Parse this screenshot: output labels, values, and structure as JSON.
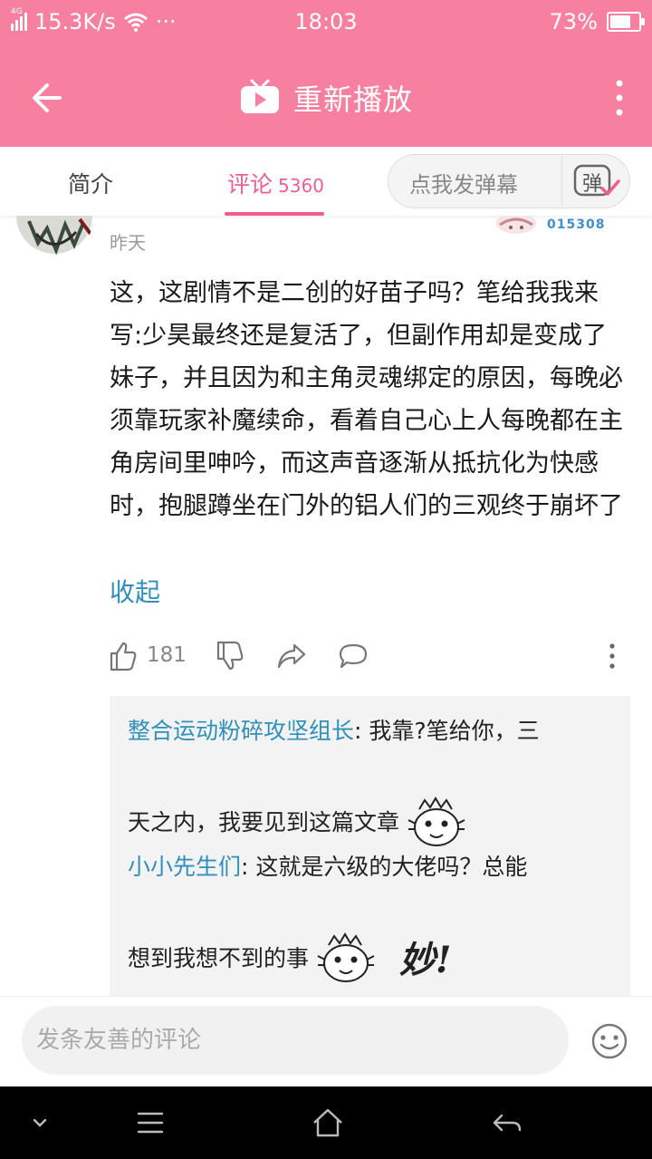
{
  "status_bar": {
    "net_type": "4G",
    "speed": "15.3K/s",
    "dots": "···",
    "time": "18:03",
    "battery": "73%",
    "battery_level": 0.73
  },
  "header": {
    "title": "重新播放"
  },
  "tabs": {
    "intro": "简介",
    "comments_label": "评论",
    "comments_count": "5360",
    "danmaku_placeholder": "点我发弹幕",
    "danmaku_button": "弹"
  },
  "comment": {
    "badge_code": "015308",
    "time": "昨天",
    "body": "这，这剧情不是二创的好苗子吗？笔给我我来写:少昊最终还是复活了，但副作用却是变成了妹子，并且因为和主角灵魂绑定的原因，每晚必须靠玩家补魔续命，看着自己心上人每晚都在主角房间里呻吟，而这声音逐渐从抵抗化为快感时，抱腿蹲坐在门外的铝人们的三观终于崩坏了",
    "collapse": "收起",
    "likes": "181"
  },
  "replies": [
    {
      "user": "整合运动粉碎攻坚组长",
      "sep": ": ",
      "text_a": "我靠?笔给你，三",
      "text_b": "天之内，我要见到这篇文章"
    },
    {
      "user": "小小先生们",
      "sep": ": ",
      "text_a": "这就是六级的大佬吗？总能",
      "text_b": "想到我想不到的事",
      "sticker_text": "妙!"
    }
  ],
  "input": {
    "placeholder": "发条友善的评论"
  },
  "colors": {
    "brand": "#f77fa0",
    "accent": "#f25d8e",
    "link": "#2f8fbd"
  }
}
